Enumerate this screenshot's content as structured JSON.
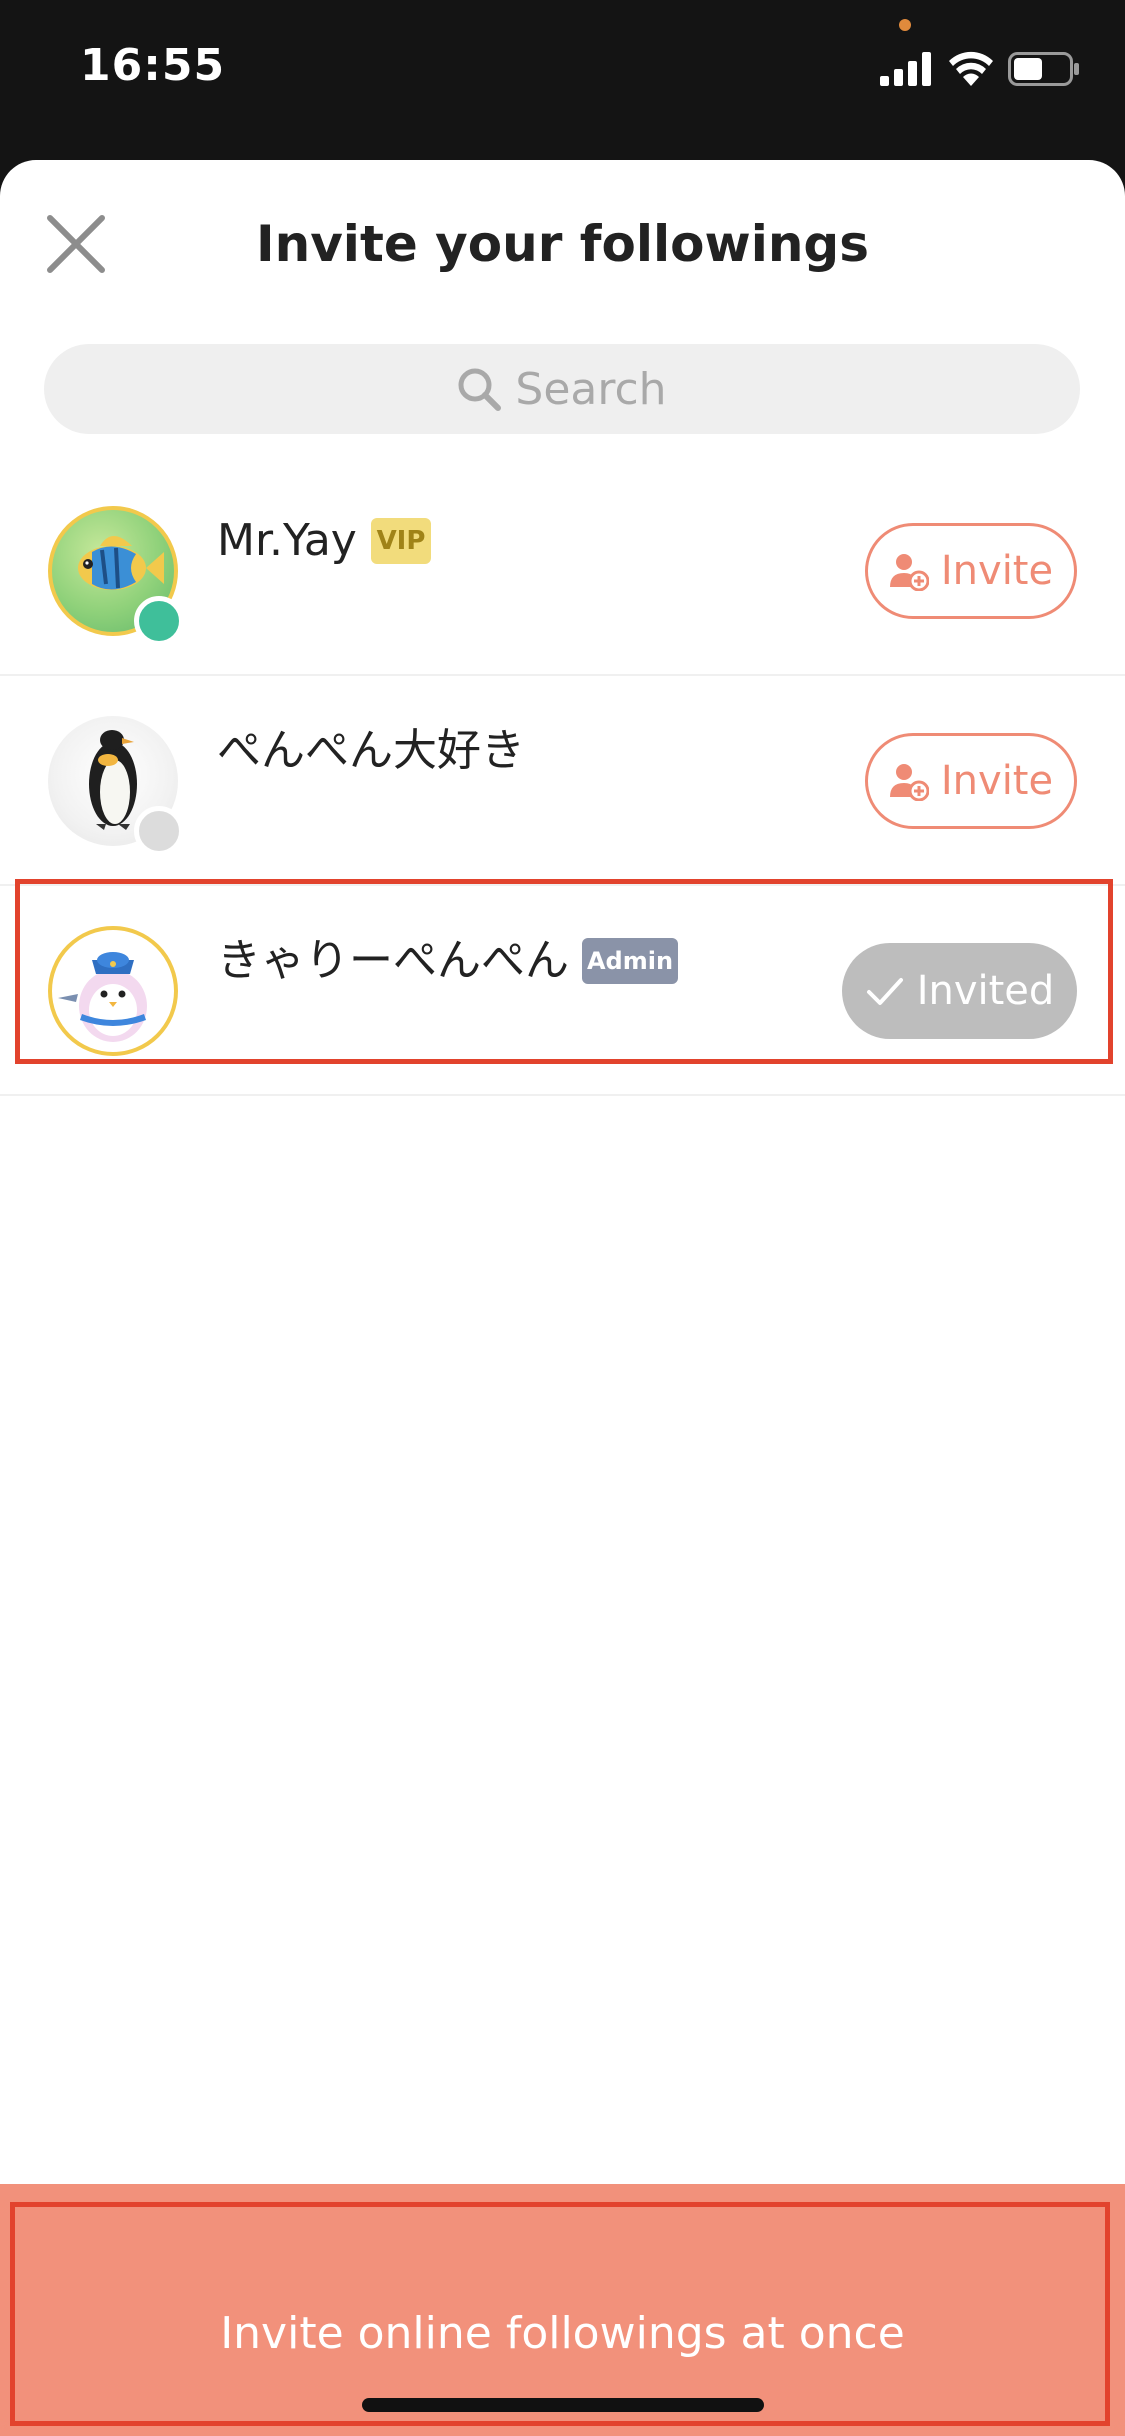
{
  "status_bar": {
    "time": "16:55"
  },
  "header": {
    "title": "Invite your followings",
    "close_icon": "close-icon"
  },
  "search": {
    "placeholder": "Search",
    "icon": "search-icon"
  },
  "users": [
    {
      "name": "Mr.Yay",
      "badge": "VIP",
      "online": true,
      "action_label": "Invite",
      "action_icon": "add-user-icon",
      "invited": false
    },
    {
      "name": "ぺんぺん大好き",
      "badge": "",
      "online": false,
      "action_label": "Invite",
      "action_icon": "add-user-icon",
      "invited": false
    },
    {
      "name": "きゃりーぺんぺん",
      "badge": "Admin",
      "online": null,
      "action_label": "Invited",
      "action_icon": "check-icon",
      "invited": true
    }
  ],
  "bottom_action": {
    "label": "Invite online followings at once"
  },
  "colors": {
    "accent": "#ef8b75",
    "bottom_bar": "#f2917b",
    "online": "#3fbf9a",
    "offline": "#dcdcdc",
    "highlight": "#e2432d",
    "vip_badge": "#f2dc7c",
    "admin_badge": "#8a93a8",
    "invited_button": "#bdbdbd"
  }
}
